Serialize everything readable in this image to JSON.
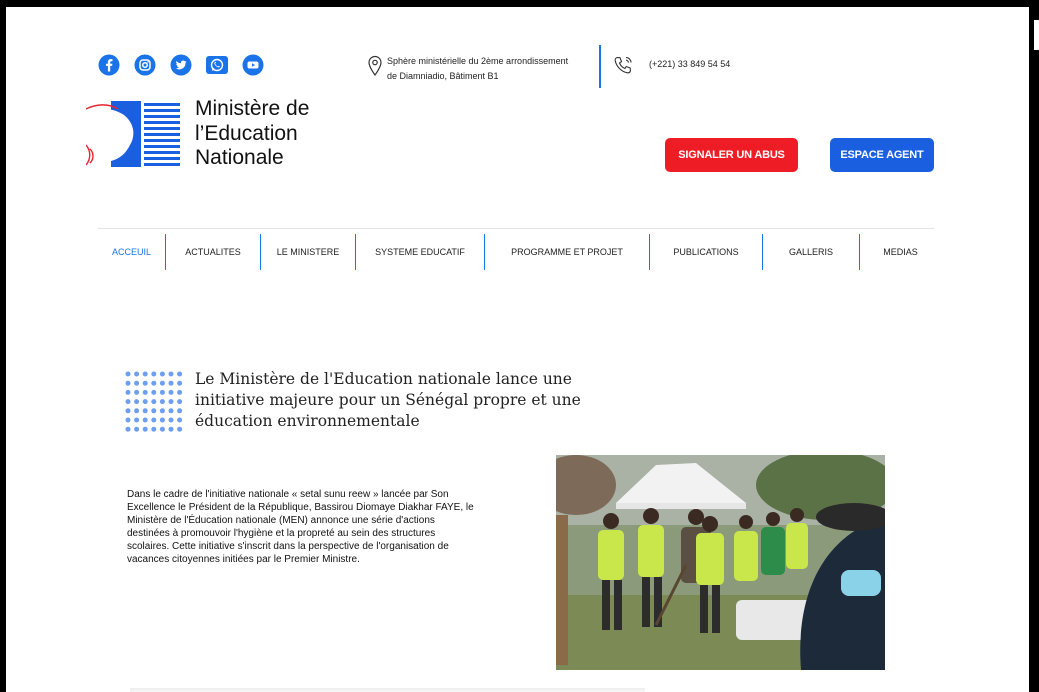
{
  "social": [
    {
      "name": "facebook",
      "icon": "facebook-icon",
      "color": "#1a73e8"
    },
    {
      "name": "instagram",
      "icon": "instagram-icon",
      "color": "#1a73e8"
    },
    {
      "name": "twitter",
      "icon": "twitter-icon",
      "color": "#1a73e8"
    },
    {
      "name": "whatsapp",
      "icon": "whatsapp-icon",
      "color": "#1a73e8"
    },
    {
      "name": "youtube",
      "icon": "youtube-icon",
      "color": "#1a73e8"
    }
  ],
  "header": {
    "address_line1": "Sphère ministérielle du 2ème arrondissement",
    "address_line2": "de Diamniadio, Bâtiment B1",
    "phone": "(+221) 33 849 54 54",
    "logo_line1": "Ministère de",
    "logo_line2": "l’Education",
    "logo_line3": "Nationale",
    "btn_abus": "SIGNALER UN ABUS",
    "btn_agent": "ESPACE AGENT"
  },
  "nav": {
    "items": [
      "ACCEUIL",
      "ACTUALITES",
      "LE MINISTERE",
      "SYSTEME EDUCATIF",
      "PROGRAMME ET PROJET",
      "PUBLICATIONS",
      "GALLERIS",
      "MEDIAS"
    ],
    "active_index": 0
  },
  "article": {
    "headline_line1": "Le Ministère de l'Education nationale lance une",
    "headline_line2": "initiative majeure pour un Sénégal propre et une",
    "headline_line3": "éducation environnementale",
    "body": [
      "Dans le cadre de l'initiative nationale « setal sunu reew » lancée par Son",
      "Excellence le Président de la République, Bassirou Diomaye Diakhar FAYE, le",
      "Ministère de l'Éducation nationale (MEN) annonce une série d'actions",
      "destinées à promouvoir l'hygiène et la propreté au sein des structures",
      "scolaires. Cette initiative s'inscrit dans la perspective de l'organisation de",
      "vacances citoyennes initiées par le Premier Ministre."
    ]
  },
  "colors": {
    "brand_blue": "#1a73e8",
    "abus_red": "#ee1c24",
    "agent_blue": "#1a5fe0"
  }
}
